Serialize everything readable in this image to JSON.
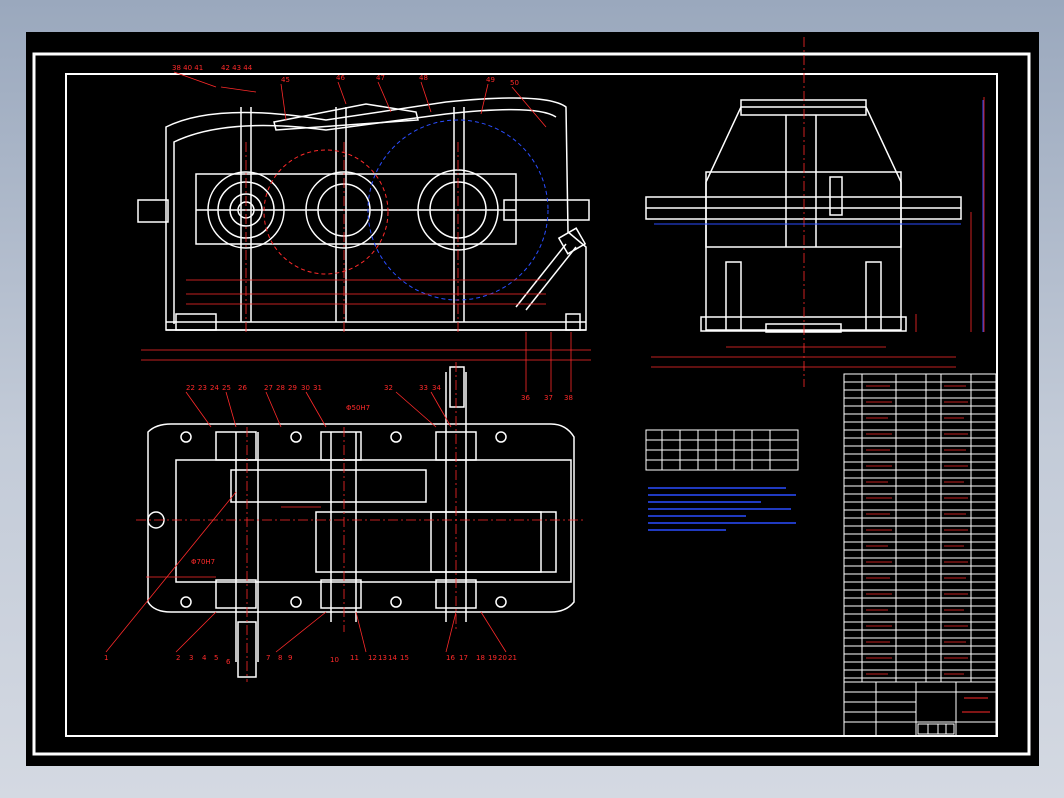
{
  "drawing": {
    "kind": "gear reducer assembly drawing",
    "background": "#000000",
    "colors": {
      "outline": "#ffffff",
      "dimension": "#ff2a2a",
      "center_line": "#ff2a2a",
      "note": "#2a4dff"
    }
  },
  "front_view": {
    "top_callouts": [
      "38 40 41",
      "42 43 44",
      "45",
      "46",
      "47",
      "48",
      "49",
      "50"
    ],
    "bottom_callouts": [
      "36",
      "37",
      "38"
    ]
  },
  "plan_view": {
    "top_callouts": [
      "22",
      "23",
      "24",
      "25",
      "26",
      "27",
      "28",
      "29",
      "30",
      "31",
      "32",
      "33",
      "34"
    ],
    "bottom_callouts": [
      "1",
      "2",
      "3",
      "4",
      "5",
      "6",
      "7",
      "8",
      "9",
      "10",
      "11",
      "12",
      "13",
      "14",
      "15",
      "16",
      "17",
      "18",
      "19",
      "20",
      "21"
    ],
    "fit_labels": [
      "Φ70H7",
      "Φ50H7"
    ]
  }
}
